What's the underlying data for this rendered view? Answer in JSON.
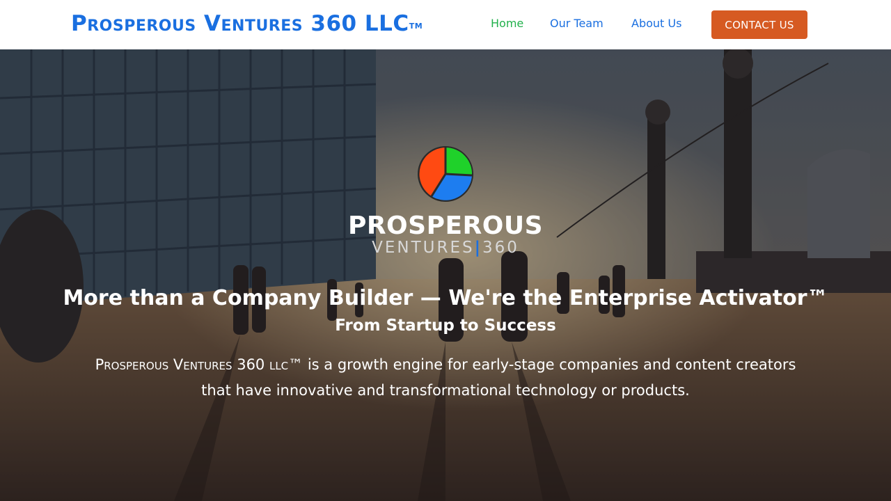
{
  "nav": {
    "brand": "Prosperous Ventures 360 LLC",
    "brand_tm": "TM",
    "links": [
      {
        "label": "Home",
        "active": true
      },
      {
        "label": "Our Team",
        "active": false
      },
      {
        "label": "About Us",
        "active": false
      }
    ],
    "contact_label": "CONTACT US"
  },
  "hero": {
    "logo_word1": "PROSPEROUS",
    "logo_word2_left": "VENTURES",
    "logo_word2_sep": "|",
    "logo_word2_right": "360",
    "headline": "More than a Company Builder — We're the Enterprise Activator™",
    "subhead": "From Startup to Success",
    "desc_company": "Prosperous Ventures 360 llc™",
    "desc_line1_rest": " is a growth engine for early-stage companies and content creators",
    "desc_line2": "that have innovative and transformational technology or products."
  },
  "colors": {
    "brand_blue": "#1a6fe0",
    "active_green": "#22b14c",
    "contact_orange": "#d65a22"
  },
  "icons": {
    "hero_logo": "tri-color-pie-logo"
  }
}
